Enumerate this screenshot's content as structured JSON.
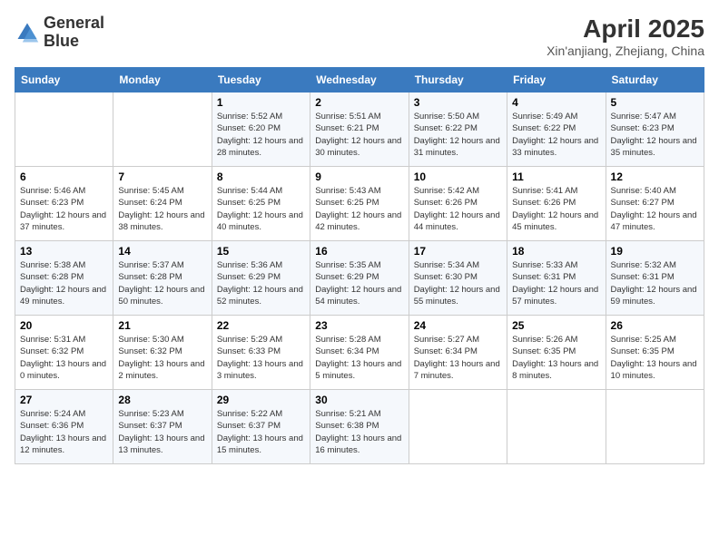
{
  "header": {
    "logo_line1": "General",
    "logo_line2": "Blue",
    "month_year": "April 2025",
    "location": "Xin'anjiang, Zhejiang, China"
  },
  "days_of_week": [
    "Sunday",
    "Monday",
    "Tuesday",
    "Wednesday",
    "Thursday",
    "Friday",
    "Saturday"
  ],
  "weeks": [
    [
      {
        "day": "",
        "sunrise": "",
        "sunset": "",
        "daylight": ""
      },
      {
        "day": "",
        "sunrise": "",
        "sunset": "",
        "daylight": ""
      },
      {
        "day": "1",
        "sunrise": "Sunrise: 5:52 AM",
        "sunset": "Sunset: 6:20 PM",
        "daylight": "Daylight: 12 hours and 28 minutes."
      },
      {
        "day": "2",
        "sunrise": "Sunrise: 5:51 AM",
        "sunset": "Sunset: 6:21 PM",
        "daylight": "Daylight: 12 hours and 30 minutes."
      },
      {
        "day": "3",
        "sunrise": "Sunrise: 5:50 AM",
        "sunset": "Sunset: 6:22 PM",
        "daylight": "Daylight: 12 hours and 31 minutes."
      },
      {
        "day": "4",
        "sunrise": "Sunrise: 5:49 AM",
        "sunset": "Sunset: 6:22 PM",
        "daylight": "Daylight: 12 hours and 33 minutes."
      },
      {
        "day": "5",
        "sunrise": "Sunrise: 5:47 AM",
        "sunset": "Sunset: 6:23 PM",
        "daylight": "Daylight: 12 hours and 35 minutes."
      }
    ],
    [
      {
        "day": "6",
        "sunrise": "Sunrise: 5:46 AM",
        "sunset": "Sunset: 6:23 PM",
        "daylight": "Daylight: 12 hours and 37 minutes."
      },
      {
        "day": "7",
        "sunrise": "Sunrise: 5:45 AM",
        "sunset": "Sunset: 6:24 PM",
        "daylight": "Daylight: 12 hours and 38 minutes."
      },
      {
        "day": "8",
        "sunrise": "Sunrise: 5:44 AM",
        "sunset": "Sunset: 6:25 PM",
        "daylight": "Daylight: 12 hours and 40 minutes."
      },
      {
        "day": "9",
        "sunrise": "Sunrise: 5:43 AM",
        "sunset": "Sunset: 6:25 PM",
        "daylight": "Daylight: 12 hours and 42 minutes."
      },
      {
        "day": "10",
        "sunrise": "Sunrise: 5:42 AM",
        "sunset": "Sunset: 6:26 PM",
        "daylight": "Daylight: 12 hours and 44 minutes."
      },
      {
        "day": "11",
        "sunrise": "Sunrise: 5:41 AM",
        "sunset": "Sunset: 6:26 PM",
        "daylight": "Daylight: 12 hours and 45 minutes."
      },
      {
        "day": "12",
        "sunrise": "Sunrise: 5:40 AM",
        "sunset": "Sunset: 6:27 PM",
        "daylight": "Daylight: 12 hours and 47 minutes."
      }
    ],
    [
      {
        "day": "13",
        "sunrise": "Sunrise: 5:38 AM",
        "sunset": "Sunset: 6:28 PM",
        "daylight": "Daylight: 12 hours and 49 minutes."
      },
      {
        "day": "14",
        "sunrise": "Sunrise: 5:37 AM",
        "sunset": "Sunset: 6:28 PM",
        "daylight": "Daylight: 12 hours and 50 minutes."
      },
      {
        "day": "15",
        "sunrise": "Sunrise: 5:36 AM",
        "sunset": "Sunset: 6:29 PM",
        "daylight": "Daylight: 12 hours and 52 minutes."
      },
      {
        "day": "16",
        "sunrise": "Sunrise: 5:35 AM",
        "sunset": "Sunset: 6:29 PM",
        "daylight": "Daylight: 12 hours and 54 minutes."
      },
      {
        "day": "17",
        "sunrise": "Sunrise: 5:34 AM",
        "sunset": "Sunset: 6:30 PM",
        "daylight": "Daylight: 12 hours and 55 minutes."
      },
      {
        "day": "18",
        "sunrise": "Sunrise: 5:33 AM",
        "sunset": "Sunset: 6:31 PM",
        "daylight": "Daylight: 12 hours and 57 minutes."
      },
      {
        "day": "19",
        "sunrise": "Sunrise: 5:32 AM",
        "sunset": "Sunset: 6:31 PM",
        "daylight": "Daylight: 12 hours and 59 minutes."
      }
    ],
    [
      {
        "day": "20",
        "sunrise": "Sunrise: 5:31 AM",
        "sunset": "Sunset: 6:32 PM",
        "daylight": "Daylight: 13 hours and 0 minutes."
      },
      {
        "day": "21",
        "sunrise": "Sunrise: 5:30 AM",
        "sunset": "Sunset: 6:32 PM",
        "daylight": "Daylight: 13 hours and 2 minutes."
      },
      {
        "day": "22",
        "sunrise": "Sunrise: 5:29 AM",
        "sunset": "Sunset: 6:33 PM",
        "daylight": "Daylight: 13 hours and 3 minutes."
      },
      {
        "day": "23",
        "sunrise": "Sunrise: 5:28 AM",
        "sunset": "Sunset: 6:34 PM",
        "daylight": "Daylight: 13 hours and 5 minutes."
      },
      {
        "day": "24",
        "sunrise": "Sunrise: 5:27 AM",
        "sunset": "Sunset: 6:34 PM",
        "daylight": "Daylight: 13 hours and 7 minutes."
      },
      {
        "day": "25",
        "sunrise": "Sunrise: 5:26 AM",
        "sunset": "Sunset: 6:35 PM",
        "daylight": "Daylight: 13 hours and 8 minutes."
      },
      {
        "day": "26",
        "sunrise": "Sunrise: 5:25 AM",
        "sunset": "Sunset: 6:35 PM",
        "daylight": "Daylight: 13 hours and 10 minutes."
      }
    ],
    [
      {
        "day": "27",
        "sunrise": "Sunrise: 5:24 AM",
        "sunset": "Sunset: 6:36 PM",
        "daylight": "Daylight: 13 hours and 12 minutes."
      },
      {
        "day": "28",
        "sunrise": "Sunrise: 5:23 AM",
        "sunset": "Sunset: 6:37 PM",
        "daylight": "Daylight: 13 hours and 13 minutes."
      },
      {
        "day": "29",
        "sunrise": "Sunrise: 5:22 AM",
        "sunset": "Sunset: 6:37 PM",
        "daylight": "Daylight: 13 hours and 15 minutes."
      },
      {
        "day": "30",
        "sunrise": "Sunrise: 5:21 AM",
        "sunset": "Sunset: 6:38 PM",
        "daylight": "Daylight: 13 hours and 16 minutes."
      },
      {
        "day": "",
        "sunrise": "",
        "sunset": "",
        "daylight": ""
      },
      {
        "day": "",
        "sunrise": "",
        "sunset": "",
        "daylight": ""
      },
      {
        "day": "",
        "sunrise": "",
        "sunset": "",
        "daylight": ""
      }
    ]
  ]
}
